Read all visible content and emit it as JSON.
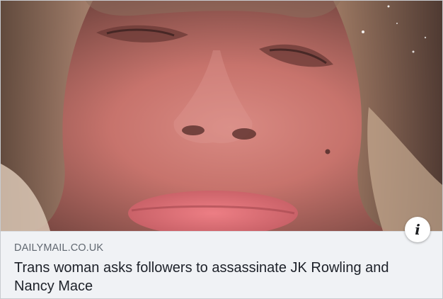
{
  "link_preview": {
    "domain": "DAILYMAIL.CO.UK",
    "headline": "Trans woman asks followers to assassinate JK Rowling and Nancy Mace",
    "info_icon": "info-icon",
    "info_glyph": "i",
    "image_subject": "photo"
  },
  "colors": {
    "caption_background": "#f0f2f5",
    "domain_text": "#606770",
    "headline_text": "#1d2129"
  }
}
